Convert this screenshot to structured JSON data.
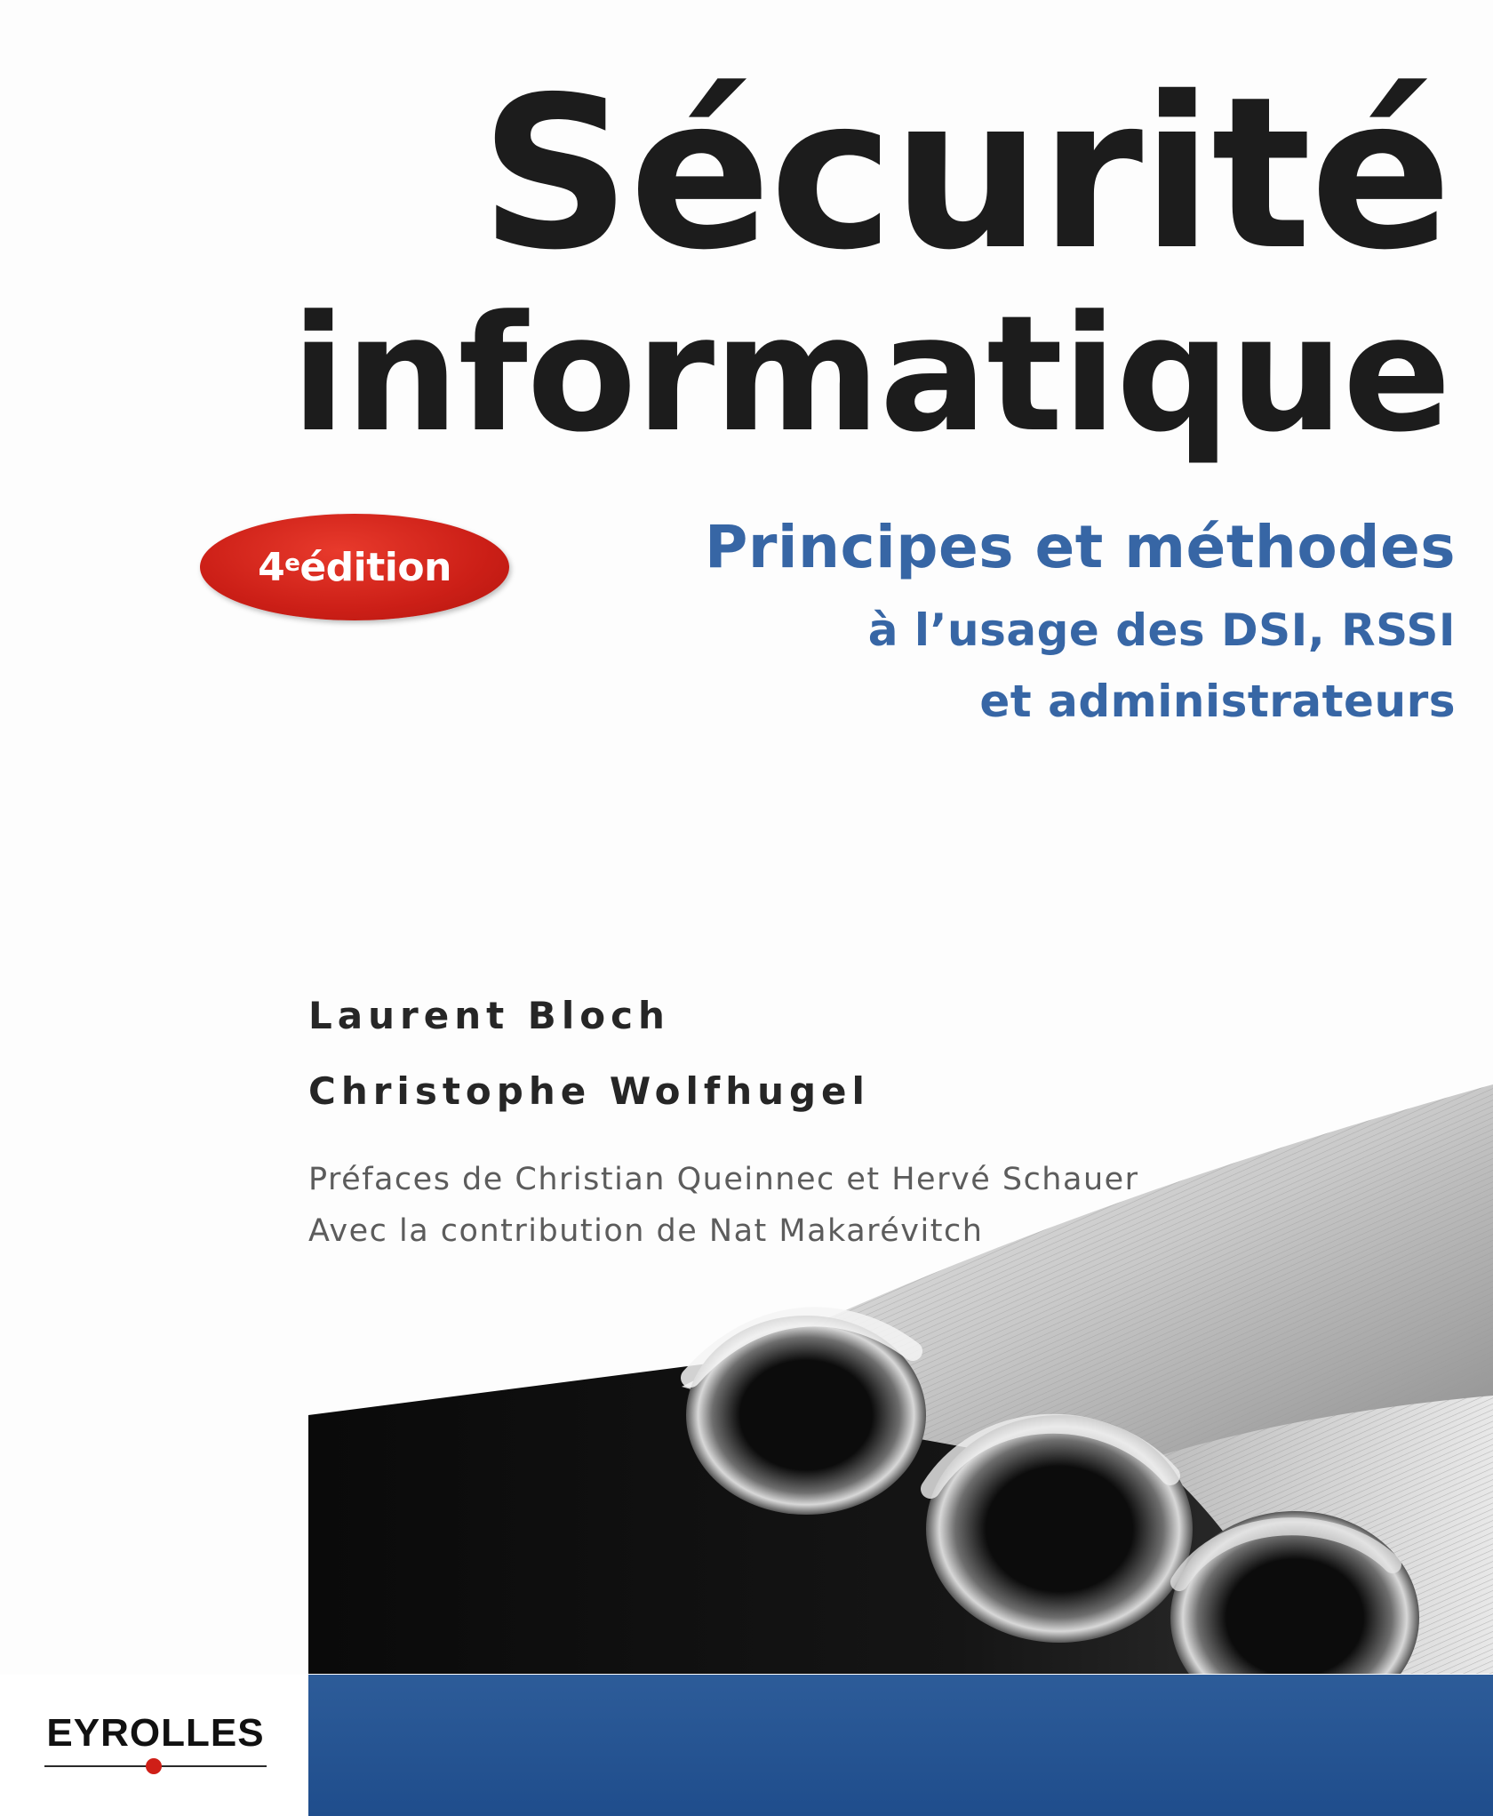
{
  "book": {
    "title_line_1": "Sécurité",
    "title_line_2": "informatique",
    "edition_number": "4",
    "edition_suffix": "e",
    "edition_word": " édition",
    "subtitle_main": "Principes et méthodes",
    "subtitle_line_2": "à l’usage des DSI, RSSI",
    "subtitle_line_3": "et administrateurs",
    "authors": [
      "Laurent Bloch",
      "Christophe Wolfhugel"
    ],
    "credits": [
      "Préfaces de Christian Queinnec et Hervé Schauer",
      "Avec la contribution de Nat Makarévitch"
    ],
    "publisher": "EYROLLES"
  },
  "colors": {
    "title": "#1c1c1c",
    "subtitle_blue": "#3766a5",
    "badge_red": "#cc1f17",
    "band_blue": "#1f4d8c"
  }
}
